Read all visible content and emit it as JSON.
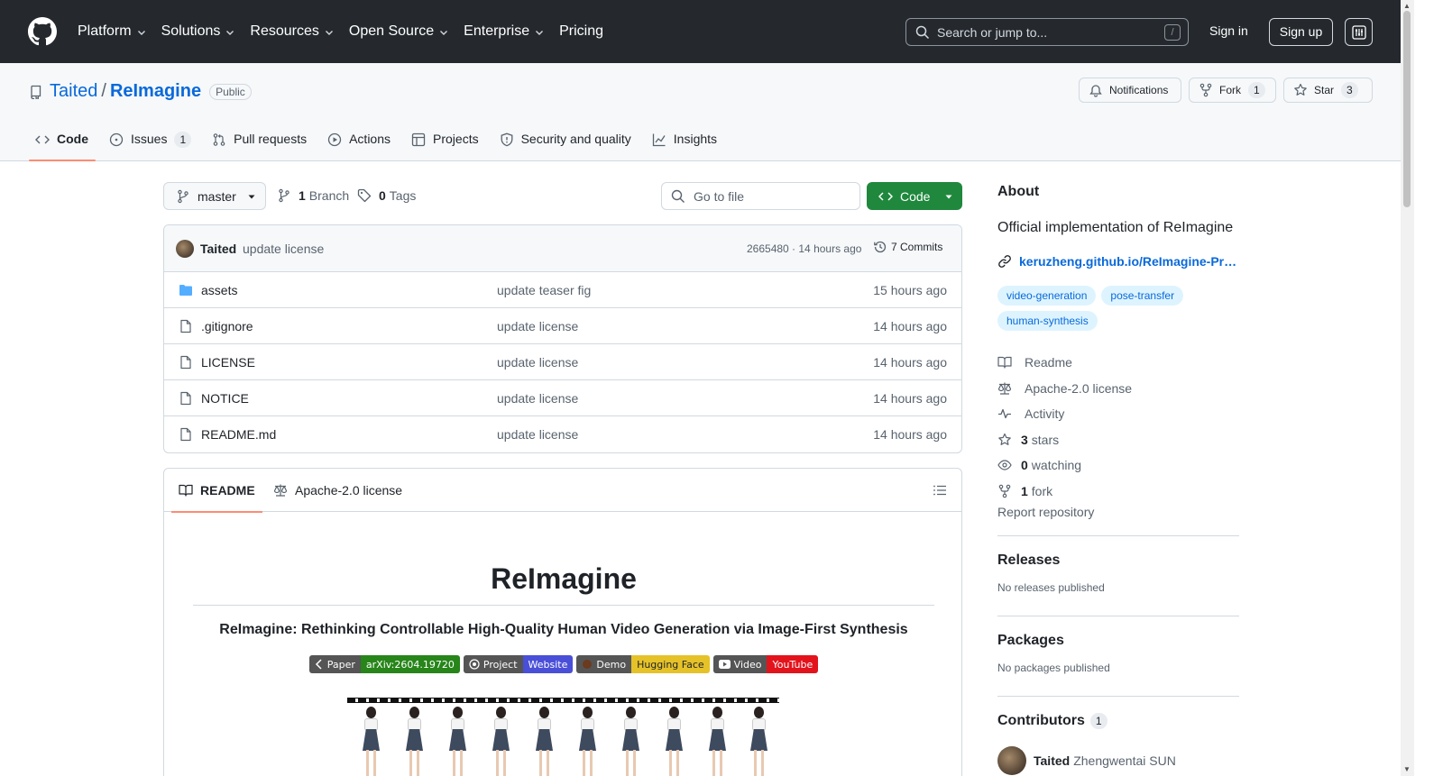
{
  "header": {
    "nav": [
      "Platform",
      "Solutions",
      "Resources",
      "Open Source",
      "Enterprise",
      "Pricing"
    ],
    "search_placeholder": "Search or jump to...",
    "search_shortcut": "/",
    "signin": "Sign in",
    "signup": "Sign up"
  },
  "repo": {
    "owner": "Taited",
    "separator": "/",
    "name": "ReImagine",
    "visibility": "Public",
    "notifications": "Notifications",
    "fork_label": "Fork",
    "fork_count": "1",
    "star_label": "Star",
    "star_count": "3"
  },
  "tabs": [
    {
      "label": "Code",
      "count": "",
      "active": true
    },
    {
      "label": "Issues",
      "count": "1"
    },
    {
      "label": "Pull requests",
      "count": ""
    },
    {
      "label": "Actions",
      "count": ""
    },
    {
      "label": "Projects",
      "count": ""
    },
    {
      "label": "Security and quality",
      "count": ""
    },
    {
      "label": "Insights",
      "count": ""
    }
  ],
  "toolbar": {
    "branch": "master",
    "branch_count": "1",
    "branch_label": "Branch",
    "tag_count": "0",
    "tag_label": "Tags",
    "go_to_file": "Go to file",
    "code_button": "Code"
  },
  "last_commit": {
    "author": "Taited",
    "message": "update license",
    "meta": "2665480 · 14 hours ago",
    "commits": "7 Commits"
  },
  "files": [
    {
      "name": "assets",
      "type": "folder",
      "message": "update teaser fig",
      "time": "15 hours ago"
    },
    {
      "name": ".gitignore",
      "type": "file",
      "message": "update license",
      "time": "14 hours ago"
    },
    {
      "name": "LICENSE",
      "type": "file",
      "message": "update license",
      "time": "14 hours ago"
    },
    {
      "name": "NOTICE",
      "type": "file",
      "message": "update license",
      "time": "14 hours ago"
    },
    {
      "name": "README.md",
      "type": "file",
      "message": "update license",
      "time": "14 hours ago"
    }
  ],
  "readme": {
    "tab_readme": "README",
    "tab_license": "Apache-2.0 license",
    "title": "ReImagine",
    "subtitle": "ReImagine: Rethinking Controllable High-Quality Human Video Generation via Image-First Synthesis",
    "badges": [
      {
        "left": "Paper",
        "right": "arXiv:2604.19720",
        "color": "#27851a"
      },
      {
        "left": "Project",
        "right": "Website",
        "color": "#4a4fd8"
      },
      {
        "left": "Demo",
        "right": "Hugging Face",
        "color": "#e6c229"
      },
      {
        "left": "Video",
        "right": "YouTube",
        "color": "#e3131c"
      }
    ]
  },
  "sidebar": {
    "about_title": "About",
    "description": "Official implementation of ReImagine",
    "website": "keruzheng.github.io/ReImagine-Pr…",
    "topics": [
      "video-generation",
      "pose-transfer",
      "human-synthesis"
    ],
    "items": [
      {
        "icon": "book-icon",
        "bold": "",
        "text": "Readme"
      },
      {
        "icon": "law-icon",
        "bold": "",
        "text": "Apache-2.0 license"
      },
      {
        "icon": "pulse-icon",
        "bold": "",
        "text": "Activity"
      },
      {
        "icon": "star-icon",
        "bold": "3",
        "text": "stars"
      },
      {
        "icon": "eye-icon",
        "bold": "0",
        "text": "watching"
      },
      {
        "icon": "fork-icon",
        "bold": "1",
        "text": "fork"
      }
    ],
    "report": "Report repository",
    "releases_title": "Releases",
    "releases_sub": "No releases published",
    "packages_title": "Packages",
    "packages_sub": "No packages published",
    "contributors_title": "Contributors",
    "contributors_count": "1",
    "contributor_login": "Taited",
    "contributor_name": "Zhengwentai SUN"
  }
}
